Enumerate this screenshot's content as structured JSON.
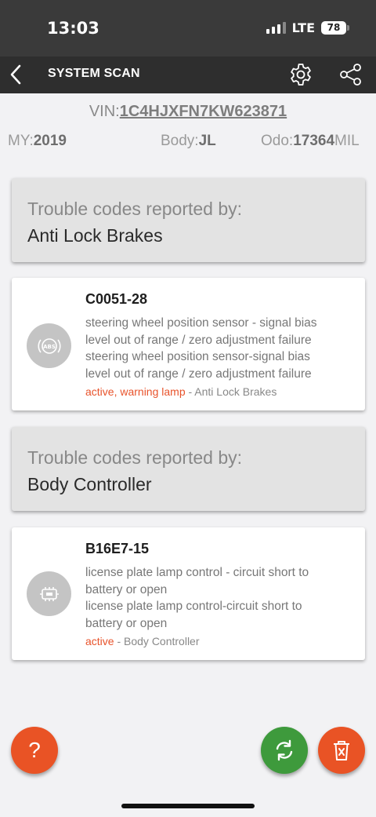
{
  "status_bar": {
    "time": "13:03",
    "network": "LTE",
    "battery": "78"
  },
  "nav": {
    "title": "SYSTEM SCAN",
    "back_icon": "chevron-left-icon",
    "settings_icon": "gear-icon",
    "share_icon": "share-icon"
  },
  "vehicle": {
    "vin_label": "VIN:",
    "vin": "1C4HJXFN7KW623871",
    "my_label": "MY:",
    "my": "2019",
    "body_label": "Body:",
    "body": "JL",
    "odo_label": "Odo:",
    "odo": "17364",
    "odo_unit": "MIL"
  },
  "sections": [
    {
      "label": "Trouble codes reported by:",
      "module": "Anti Lock Brakes",
      "codes": [
        {
          "icon": "abs-icon",
          "code": "C0051-28",
          "desc_lines": [
            "steering wheel position sensor - signal bias",
            "level out of range / zero adjustment failure",
            "steering wheel position sensor-signal bias",
            "level out of range / zero adjustment failure"
          ],
          "status": "active, warning lamp",
          "status_module": "- Anti Lock Brakes"
        }
      ]
    },
    {
      "label": "Trouble codes reported by:",
      "module": "Body Controller",
      "codes": [
        {
          "icon": "body-controller-icon",
          "code": "B16E7-15",
          "desc_lines": [
            "license plate lamp control - circuit short to",
            "battery or open",
            "license plate lamp control-circuit short to",
            "battery or open"
          ],
          "status": "active",
          "status_module": "- Body Controller"
        }
      ]
    }
  ],
  "fabs": {
    "help_label": "?",
    "refresh_icon": "refresh-icon",
    "delete_icon": "trash-icon"
  },
  "colors": {
    "accent_orange": "#e95325",
    "refresh_green": "#3e9a3c",
    "nav_dark": "#2e2e2e"
  }
}
